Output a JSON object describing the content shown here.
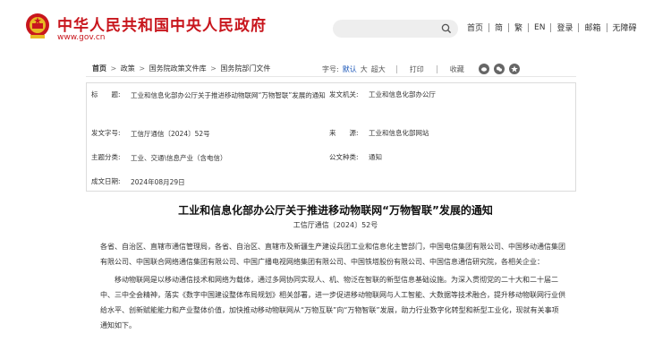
{
  "header": {
    "site_title": "中华人民共和国中央人民政府",
    "site_url": "www.gov.cn"
  },
  "search": {
    "placeholder": "",
    "value": ""
  },
  "topnav": {
    "items": [
      "首页",
      "简",
      "繁",
      "EN",
      "登录",
      "邮箱",
      "无障碍"
    ]
  },
  "breadcrumb": {
    "items": [
      "首页",
      "政策",
      "国务院政策文件库",
      "国务院部门文件"
    ],
    "separator": ">"
  },
  "tools": {
    "font_label": "字号:",
    "font_sizes": [
      "默认",
      "大",
      "超大"
    ],
    "active_font": "默认",
    "print_label": "打印",
    "favorite_label": "收藏",
    "share_icons": [
      "weibo-icon",
      "wechat-icon",
      "qzone-icon"
    ]
  },
  "meta": {
    "title_key": "标　　题:",
    "title_value": "工业和信息化部办公厅关于推进移动物联网“万物智联”发展的通知",
    "issuer_key": "发文机关:",
    "issuer_value": "工业和信息化部办公厅",
    "docno_key": "发文字号:",
    "docno_value": "工信厅通信〔2024〕52号",
    "source_key": "来　　源:",
    "source_value": "工业和信息化部网站",
    "topic_key": "主题分类:",
    "topic_value": "工业、交通\\信息产业（含电信）",
    "type_key": "公文种类:",
    "type_value": "通知",
    "date_key": "成文日期:",
    "date_value": "2024年08月29日"
  },
  "doc": {
    "title": "工业和信息化部办公厅关于推进移动物联网“万物智联”发展的通知",
    "number": "工信厅通信〔2024〕52号",
    "salutation": "各省、自治区、直辖市通信管理局，各省、自治区、直辖市及新疆生产建设兵团工业和信息化主管部门，中国电信集团有限公司、中国移动通信集团有限公司、中国联合网络通信集团有限公司、中国广播电视网络集团有限公司、中国铁塔股份有限公司、中国信息通信研究院，各相关企业：",
    "paragraph1": "移动物联网是以移动通信技术和网络为载体，通过多网协同实现人、机、物泛在智联的新型信息基础设施。为深入贯彻党的二十大和二十届二中、三中全会精神，落实《数字中国建设整体布局规划》相关部署，进一步促进移动物联网与人工智能、大数据等技术融合，提升移动物联网行业供给水平、创新赋能能力和产业整体价值，加快推动移动物联网从“万物互联”向“万物智联”发展，助力行业数字化转型和新型工业化，现就有关事项通知如下。"
  },
  "colors": {
    "brand_red": "#c8161d",
    "link_blue": "#1a56b8"
  }
}
